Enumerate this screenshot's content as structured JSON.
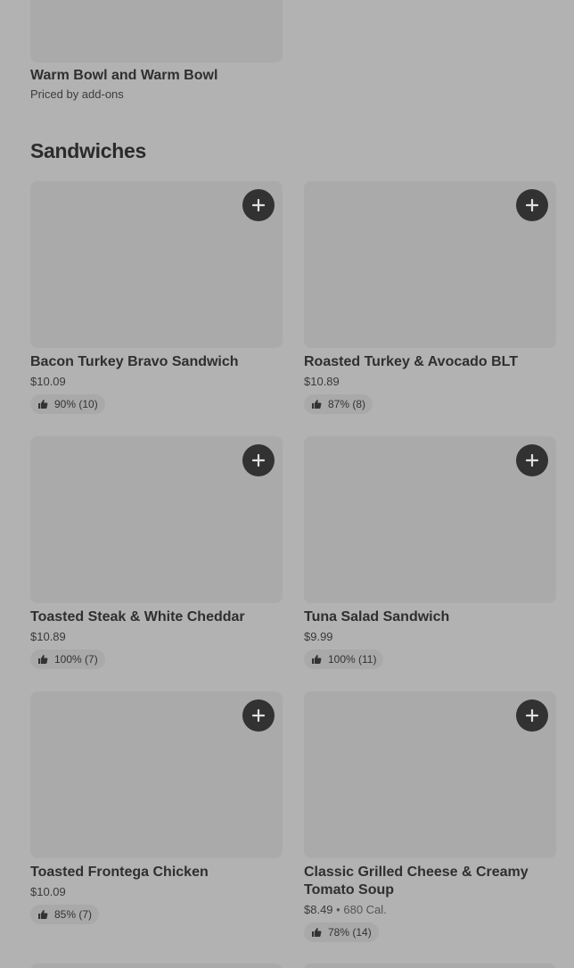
{
  "top_item": {
    "title": "Warm Bowl and Warm Bowl",
    "subtitle": "Priced by add-ons"
  },
  "section": {
    "title": "Sandwiches"
  },
  "items": [
    {
      "title": "Bacon Turkey Bravo Sandwich",
      "price": "$10.09",
      "rating": "90% (10)"
    },
    {
      "title": "Roasted Turkey & Avocado BLT",
      "price": "$10.89",
      "rating": "87% (8)"
    },
    {
      "title": "Toasted Steak & White Cheddar",
      "price": "$10.89",
      "rating": "100% (7)"
    },
    {
      "title": "Tuna Salad Sandwich",
      "price": "$9.99",
      "rating": "100% (11)"
    },
    {
      "title": "Toasted Frontega Chicken",
      "price": "$10.09",
      "rating": "85% (7)"
    },
    {
      "title": "Classic Grilled Cheese & Creamy Tomato Soup",
      "price": "$8.49",
      "separator": "•",
      "calories": "680 Cal.",
      "rating": "78% (14)"
    }
  ],
  "icons": {
    "add": "plus-icon",
    "rating": "thumbs-up-icon"
  }
}
